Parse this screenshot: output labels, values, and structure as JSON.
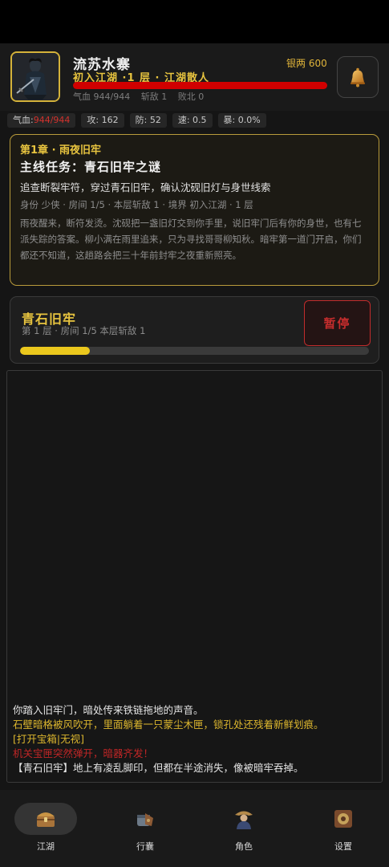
{
  "player": {
    "name": "流苏水寨",
    "subtitle": "初入江湖 ·1 层 · 江湖散人",
    "silver": "银两 600",
    "hp_text": "气血 944/944",
    "kills_text": "斩敌 1",
    "defeats_text": "败北 0",
    "hp_fraction": 1.0
  },
  "stats": {
    "hp_label": "气血:",
    "hp_value": "944/944",
    "attack": "攻: 162",
    "defense": "防: 52",
    "speed": "速: 0.5",
    "crit": "暴: 0.0%"
  },
  "quest": {
    "chapter": "第1章 · 雨夜旧牢",
    "title": "主线任务：青石旧牢之谜",
    "desc": "追查断裂牢符，穿过青石旧牢，确认沈砚旧灯与身世线索",
    "meta": "身份 少侠 · 房间 1/5 · 本层斩敌 1 · 境界 初入江湖 · 1 层",
    "story": "雨夜醒来，断符发烫。沈砚把一盏旧灯交到你手里，说旧牢门后有你的身世，也有七派失踪的答案。柳小满在雨里追来，只为寻找哥哥柳知秋。暗牢第一道门开启，你们都还不知道，这趟路会把三十年前封牢之夜重新照亮。"
  },
  "dungeon": {
    "name": "青石旧牢",
    "info": "第 1 层 · 房间 1/5   本层斩敌 1",
    "pause_label": "暂停",
    "progress": 0.2
  },
  "log": {
    "line1": "你踏入旧牢门，暗处传来铁链拖地的声音。",
    "line2": "石壁暗格被风吹开，里面躺着一只蒙尘木匣，锁孔处还残着新鲜划痕。",
    "line3": "[打开宝箱|无视]",
    "line4": "机关宝匣突然弹开，暗器齐发！",
    "line5": "【青石旧牢】地上有凌乱脚印，但都在半途消失，像被暗牢吞掉。"
  },
  "nav": {
    "jianghu": "江湖",
    "xingnang": "行囊",
    "juese": "角色",
    "shezhi": "设置"
  },
  "colors": {
    "gold": "#e8c43f",
    "hp_red": "#d10000",
    "progress_yellow": "#ebc81d",
    "danger_red": "#c12c2c"
  },
  "icons": {
    "bell": "bell-icon",
    "jianghu": "treasure-chest-icon",
    "xingnang": "backpack-icon",
    "juese": "character-icon",
    "shezhi": "settings-icon"
  }
}
